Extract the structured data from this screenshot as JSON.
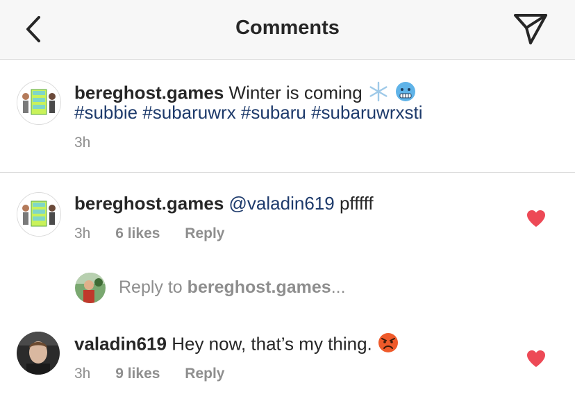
{
  "header": {
    "title": "Comments"
  },
  "caption": {
    "username": "bereghost.games",
    "text": "Winter is coming",
    "hashtags": "#subbie #subaruwrx #subaru #subaruwrxsti",
    "time": "3h"
  },
  "comments": [
    {
      "username": "bereghost.games",
      "mention": "@valadin619",
      "text": "pfffff",
      "time": "3h",
      "likes": "6 likes",
      "reply_label": "Reply",
      "liked": true
    },
    {
      "username": "valadin619",
      "text": "Hey now, that’s my thing.",
      "time": "3h",
      "likes": "9 likes",
      "reply_label": "Reply",
      "liked": true
    }
  ],
  "reply_input": {
    "prefix": "Reply to",
    "target": "bereghost.games",
    "suffix": "..."
  },
  "icons": {
    "back": "chevron-left-icon",
    "share": "paper-plane-icon",
    "heart": "heart-icon"
  },
  "colors": {
    "heart": "#ed4956",
    "link": "#1d3a6b",
    "muted": "#8e8e8e"
  }
}
